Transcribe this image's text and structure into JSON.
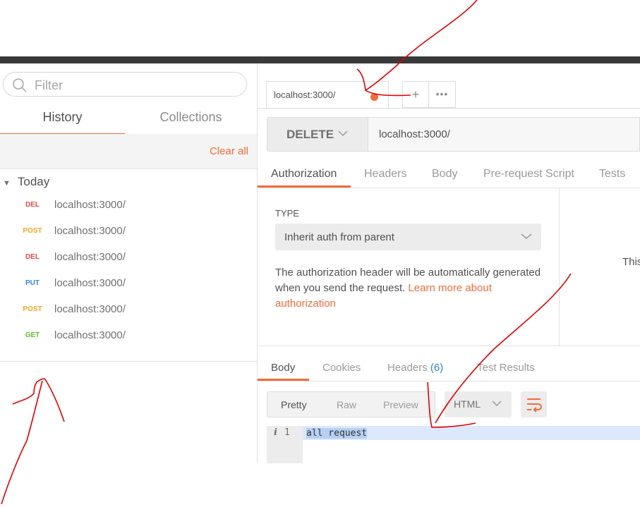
{
  "sidebar": {
    "filter_placeholder": "Filter",
    "tabs": [
      {
        "label": "History"
      },
      {
        "label": "Collections"
      }
    ],
    "clear_all": "Clear all",
    "group": "Today",
    "history": [
      {
        "method": "DEL",
        "url": "localhost:3000/",
        "color": "#e04b4b"
      },
      {
        "method": "POST",
        "url": "localhost:3000/",
        "color": "#f5a623"
      },
      {
        "method": "DEL",
        "url": "localhost:3000/",
        "color": "#e04b4b"
      },
      {
        "method": "PUT",
        "url": "localhost:3000/",
        "color": "#3a86d6"
      },
      {
        "method": "POST",
        "url": "localhost:3000/",
        "color": "#f5a623"
      },
      {
        "method": "GET",
        "url": "localhost:3000/",
        "color": "#62c12b"
      }
    ]
  },
  "request": {
    "tab_title": "localhost:3000/",
    "new_tab": "+",
    "more": "•••",
    "method": "DELETE",
    "url": "localhost:3000/",
    "tabs": [
      {
        "label": "Authorization"
      },
      {
        "label": "Headers"
      },
      {
        "label": "Body"
      },
      {
        "label": "Pre-request Script"
      },
      {
        "label": "Tests"
      }
    ]
  },
  "auth": {
    "type_label": "TYPE",
    "type_value": "Inherit auth from parent",
    "desc": "The authorization header will be automatically generated when you send the request.",
    "link": "Learn more about authorization",
    "side_text": "This"
  },
  "response": {
    "tabs": [
      {
        "label": "Body"
      },
      {
        "label": "Cookies"
      },
      {
        "label": "Headers",
        "count": "(6)"
      },
      {
        "label": "Test Results"
      }
    ],
    "formats": [
      "Pretty",
      "Raw",
      "Preview"
    ],
    "language": "HTML",
    "line_info": "i",
    "line_no": "1",
    "content": "all request"
  },
  "colors": {
    "accent": "#f26b3a",
    "annotation": "#e00000"
  }
}
